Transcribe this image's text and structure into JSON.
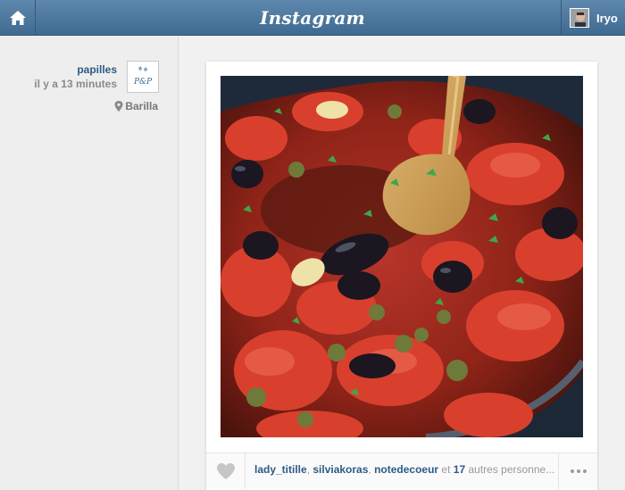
{
  "header": {
    "brand": "Instagram",
    "user_name": "Iryo",
    "home_icon": "home-icon"
  },
  "post": {
    "author": "papilles",
    "time_ago": "il y a 13 minutes",
    "location": "Barilla",
    "avatar_text": "P&P",
    "likes": {
      "user1": "lady_titille",
      "sep1": ", ",
      "user2": "silviakoras",
      "sep2": ", ",
      "user3": "notedecoeur",
      "and": " et ",
      "count": "17",
      "rest": " autres personne..."
    }
  },
  "colors": {
    "header": "#4a749b",
    "link": "#2d5a86"
  }
}
